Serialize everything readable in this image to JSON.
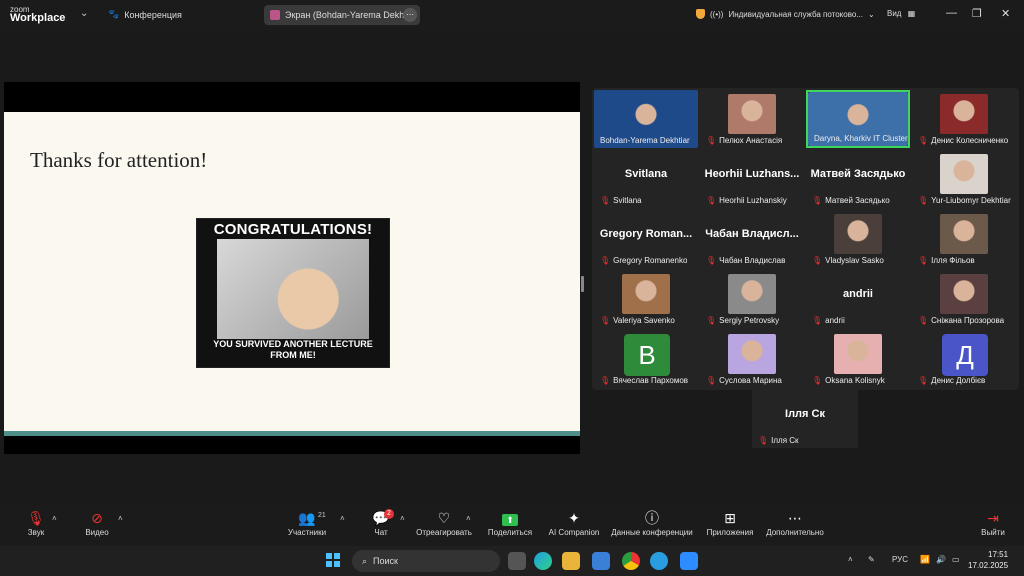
{
  "topbar": {
    "logo_line1": "zoom",
    "logo_line2": "Workplace",
    "meeting_label": "Конференция",
    "screen_share_label": "Экран (Bohdan-Yarema Dekhtiar",
    "stream_label": "Индивидуальная служба потоково...",
    "view_label": "Вид"
  },
  "slide": {
    "title": "Thanks for attention!",
    "meme_top": "CONGRATULATIONS!",
    "meme_bottom": "YOU SURVIVED ANOTHER LECTURE FROM ME!"
  },
  "participants": [
    {
      "name": "Bohdan-Yarema Dekhtiar",
      "big": "",
      "muted": false,
      "kind": "photo",
      "color": "#1f4a8a"
    },
    {
      "name": "Пелюх Анастасія",
      "big": "",
      "muted": true,
      "kind": "photo",
      "color": "#b07a6a"
    },
    {
      "name": "Daryna, Kharkiv IT Cluster",
      "big": "",
      "muted": false,
      "kind": "photo",
      "color": "#3d6fa8",
      "active": true
    },
    {
      "name": "Денис Колесниченко",
      "big": "",
      "muted": true,
      "kind": "photo",
      "color": "#8a2a2a"
    },
    {
      "name": "Svitlana",
      "big": "Svitlana",
      "muted": true,
      "kind": "text"
    },
    {
      "name": "Heorhii Luzhanskiy",
      "big": "Heorhii Luzhans...",
      "muted": true,
      "kind": "text"
    },
    {
      "name": "Матвей Засядько",
      "big": "Матвей Засядько",
      "muted": true,
      "kind": "text"
    },
    {
      "name": "Yur-Liubomyr Dekhtiar",
      "big": "",
      "muted": true,
      "kind": "photo",
      "color": "#d9d3cc"
    },
    {
      "name": "Gregory Romanenko",
      "big": "Gregory Roman...",
      "muted": true,
      "kind": "text"
    },
    {
      "name": "Чабан Владислав",
      "big": "Чабан Владисл...",
      "muted": true,
      "kind": "text"
    },
    {
      "name": "Vladyslav Sasko",
      "big": "",
      "muted": true,
      "kind": "photo",
      "color": "#4a3f3a"
    },
    {
      "name": "Ілля Фільов",
      "big": "",
      "muted": true,
      "kind": "photo",
      "color": "#6b5a4a"
    },
    {
      "name": "Valeriya Savenko",
      "big": "",
      "muted": true,
      "kind": "photo",
      "color": "#a0704a"
    },
    {
      "name": "Sergiy Petrovsky",
      "big": "",
      "muted": true,
      "kind": "photo",
      "color": "#8a8a8a"
    },
    {
      "name": "andrii",
      "big": "andrii",
      "muted": true,
      "kind": "text"
    },
    {
      "name": "Сніжана Прозорова",
      "big": "",
      "muted": true,
      "kind": "photo",
      "color": "#5a4040"
    },
    {
      "name": "Вячеслав Пархомов",
      "big": "",
      "muted": true,
      "kind": "letter",
      "letter": "В",
      "color": "#2e8b3a"
    },
    {
      "name": "Суслова Марина",
      "big": "",
      "muted": true,
      "kind": "photo",
      "color": "#b9a6e0"
    },
    {
      "name": "Oksana Kolisnyk",
      "big": "",
      "muted": true,
      "kind": "photo",
      "color": "#e6b0b0"
    },
    {
      "name": "Денис Долбієв",
      "big": "",
      "muted": true,
      "kind": "letter",
      "letter": "Д",
      "color": "#4a55c8"
    }
  ],
  "extra_participant": {
    "name": "Ілля Ск",
    "big": "Ілля Ск"
  },
  "toolbar": {
    "audio": "Звук",
    "video": "Видео",
    "participants": "Участники",
    "participants_count": "21",
    "chat": "Чат",
    "chat_count": "2",
    "react": "Отреагировать",
    "share": "Поделиться",
    "ai": "AI Companion",
    "info": "Данные конференции",
    "apps": "Приложения",
    "more": "Дополнительно",
    "leave": "Выйти"
  },
  "taskbar": {
    "search": "Поиск",
    "lang": "РУС",
    "time": "17:51",
    "date": "17.02.2025"
  }
}
